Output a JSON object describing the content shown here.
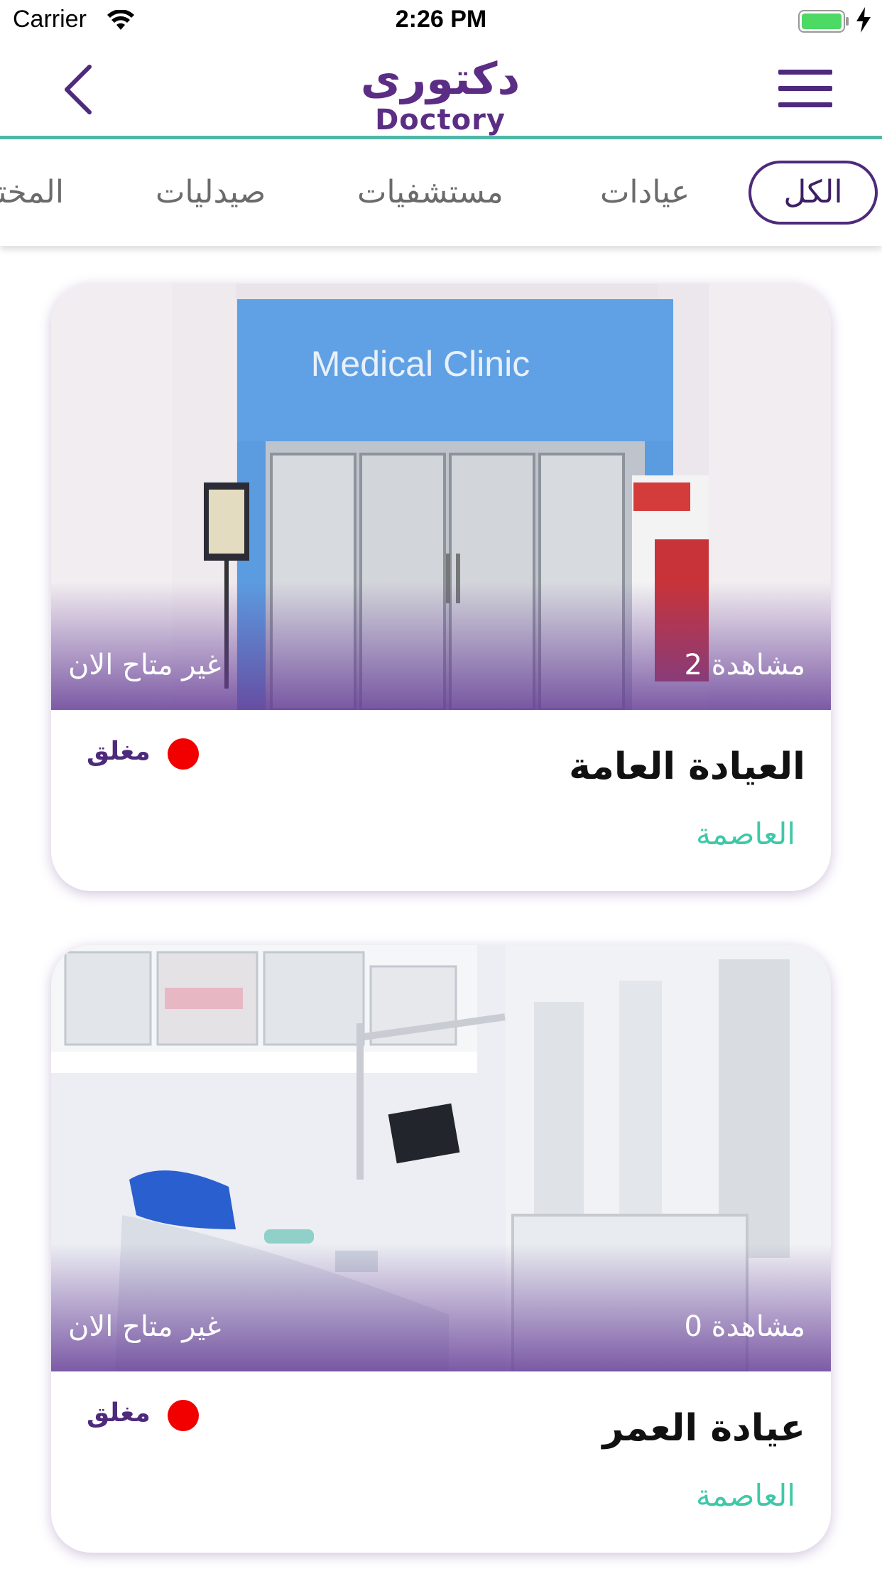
{
  "status_bar": {
    "carrier": "Carrier",
    "time": "2:26 PM"
  },
  "header": {
    "logo_ar": "دكتورى",
    "logo_en": "Doctory",
    "back_icon": "chevron-left-icon",
    "menu_icon": "hamburger-menu-icon"
  },
  "tabs": [
    {
      "label": "الكل",
      "active": true
    },
    {
      "label": "عيادات",
      "active": false
    },
    {
      "label": "مستشفيات",
      "active": false
    },
    {
      "label": "صيدليات",
      "active": false
    },
    {
      "label": "المختبرات",
      "active": false
    }
  ],
  "cards": [
    {
      "title": "العيادة العامة",
      "location": "العاصمة",
      "views": "2 مشاهدة",
      "availability": "غير متاح الان",
      "status": "مغلق",
      "image_sign": "Medical Clinic"
    },
    {
      "title": "عيادة العمر",
      "location": "العاصمة",
      "views": "0 مشاهدة",
      "availability": "غير متاح الان",
      "status": "مغلق"
    }
  ],
  "colors": {
    "brand_purple": "#4e2a7c",
    "accent_teal": "#4fb8a6",
    "location_green": "#3fc8a8",
    "status_red": "#f20000"
  }
}
